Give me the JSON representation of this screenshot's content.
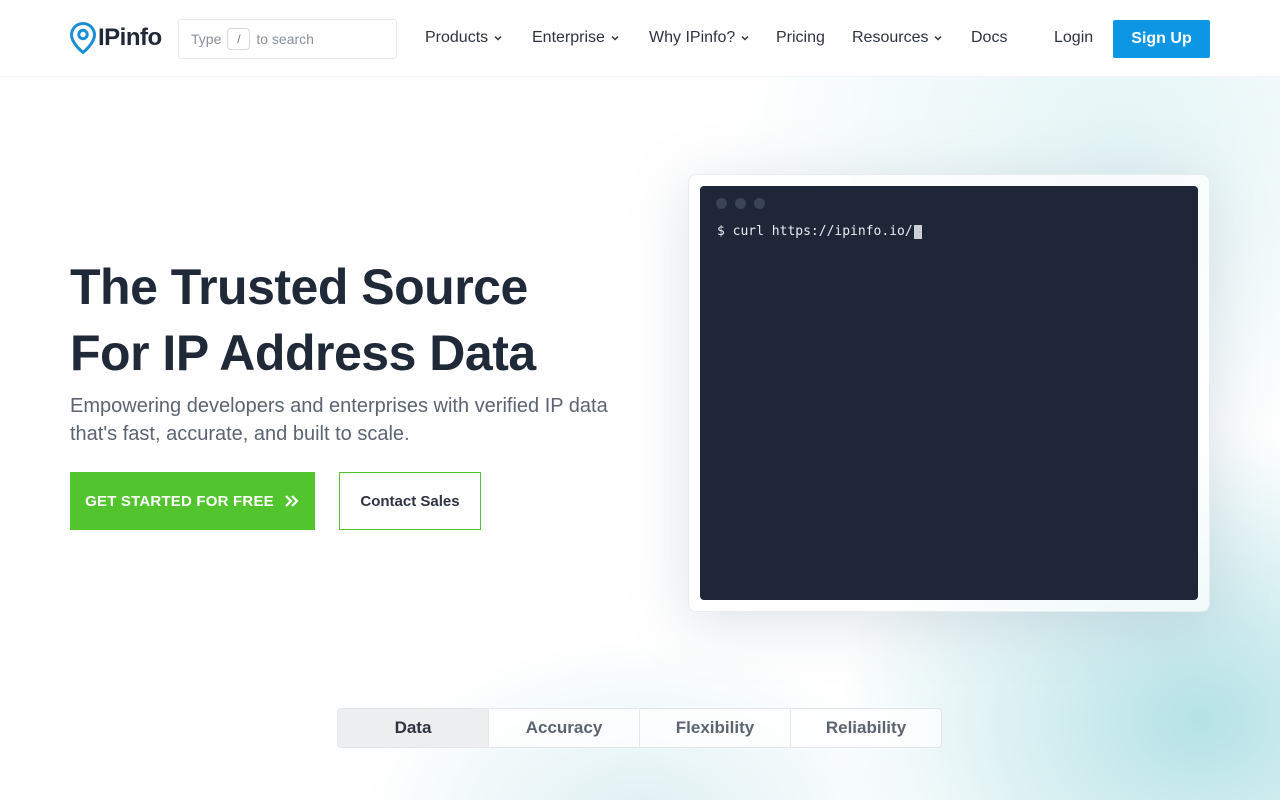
{
  "header": {
    "logo_text": "IPinfo",
    "search": {
      "prefix": "Type",
      "key": "/",
      "suffix": "to search"
    },
    "nav": [
      {
        "label": "Products",
        "has_dropdown": true
      },
      {
        "label": "Enterprise",
        "has_dropdown": true
      },
      {
        "label": "Why IPinfo?",
        "has_dropdown": true
      },
      {
        "label": "Pricing",
        "has_dropdown": false
      },
      {
        "label": "Resources",
        "has_dropdown": true
      },
      {
        "label": "Docs",
        "has_dropdown": false
      }
    ],
    "login_label": "Login",
    "signup_label": "Sign Up"
  },
  "hero": {
    "title_line1": "The Trusted Source",
    "title_line2": "For IP Address Data",
    "subtitle": "Empowering developers and enterprises with verified IP data that's fast, accurate, and built to scale.",
    "primary_cta": "GET STARTED FOR FREE",
    "secondary_cta": "Contact Sales"
  },
  "terminal": {
    "prompt": "$",
    "command": "curl https://ipinfo.io/"
  },
  "tabs": [
    {
      "label": "Data",
      "active": true
    },
    {
      "label": "Accuracy",
      "active": false
    },
    {
      "label": "Flexibility",
      "active": false
    },
    {
      "label": "Reliability",
      "active": false
    }
  ],
  "colors": {
    "brand_blue": "#0d96e3",
    "cta_green": "#52c42e",
    "terminal_bg": "#1e2638",
    "text_dark": "#1f2937"
  }
}
